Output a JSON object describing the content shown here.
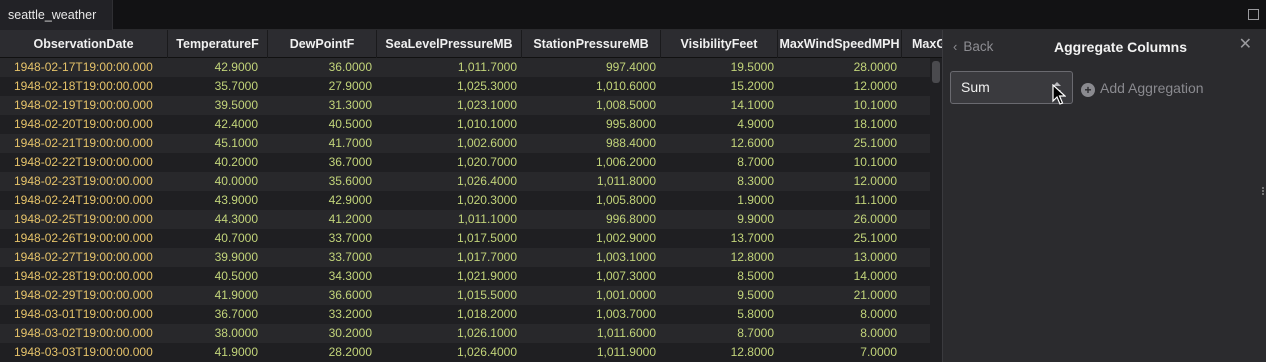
{
  "tab": {
    "title": "seattle_weather"
  },
  "columns": [
    "ObservationDate",
    "TemperatureF",
    "DewPointF",
    "SeaLevelPressureMB",
    "StationPressureMB",
    "VisibilityFeet",
    "MaxWindSpeedMPH",
    "MaxG"
  ],
  "rows": [
    [
      "1948-02-17T19:00:00.000",
      "42.9000",
      "36.0000",
      "1,011.7000",
      "997.4000",
      "19.5000",
      "28.0000"
    ],
    [
      "1948-02-18T19:00:00.000",
      "35.7000",
      "27.9000",
      "1,025.3000",
      "1,010.6000",
      "15.2000",
      "12.0000"
    ],
    [
      "1948-02-19T19:00:00.000",
      "39.5000",
      "31.3000",
      "1,023.1000",
      "1,008.5000",
      "14.1000",
      "10.1000"
    ],
    [
      "1948-02-20T19:00:00.000",
      "42.4000",
      "40.5000",
      "1,010.1000",
      "995.8000",
      "4.9000",
      "18.1000"
    ],
    [
      "1948-02-21T19:00:00.000",
      "45.1000",
      "41.7000",
      "1,002.6000",
      "988.4000",
      "12.6000",
      "25.1000"
    ],
    [
      "1948-02-22T19:00:00.000",
      "40.2000",
      "36.7000",
      "1,020.7000",
      "1,006.2000",
      "8.7000",
      "10.1000"
    ],
    [
      "1948-02-23T19:00:00.000",
      "40.0000",
      "35.6000",
      "1,026.4000",
      "1,011.8000",
      "8.3000",
      "12.0000"
    ],
    [
      "1948-02-24T19:00:00.000",
      "43.9000",
      "42.9000",
      "1,020.3000",
      "1,005.8000",
      "1.9000",
      "11.1000"
    ],
    [
      "1948-02-25T19:00:00.000",
      "44.3000",
      "41.2000",
      "1,011.1000",
      "996.8000",
      "9.9000",
      "26.0000"
    ],
    [
      "1948-02-26T19:00:00.000",
      "40.7000",
      "33.7000",
      "1,017.5000",
      "1,002.9000",
      "13.7000",
      "25.1000"
    ],
    [
      "1948-02-27T19:00:00.000",
      "39.9000",
      "33.7000",
      "1,017.7000",
      "1,003.1000",
      "12.8000",
      "13.0000"
    ],
    [
      "1948-02-28T19:00:00.000",
      "40.5000",
      "34.3000",
      "1,021.9000",
      "1,007.3000",
      "8.5000",
      "14.0000"
    ],
    [
      "1948-02-29T19:00:00.000",
      "41.9000",
      "36.6000",
      "1,015.5000",
      "1,001.0000",
      "9.5000",
      "21.0000"
    ],
    [
      "1948-03-01T19:00:00.000",
      "36.7000",
      "33.2000",
      "1,018.2000",
      "1,003.7000",
      "5.8000",
      "8.0000"
    ],
    [
      "1948-03-02T19:00:00.000",
      "38.0000",
      "30.2000",
      "1,026.1000",
      "1,011.6000",
      "8.7000",
      "8.0000"
    ],
    [
      "1948-03-03T19:00:00.000",
      "41.9000",
      "28.2000",
      "1,026.4000",
      "1,011.9000",
      "12.8000",
      "7.0000"
    ]
  ],
  "panel": {
    "back_label": "Back",
    "title": "Aggregate Columns",
    "close_icon": "close-icon",
    "aggregation_select": {
      "value": "Sum"
    },
    "add_aggregation_label": "Add Aggregation"
  },
  "colors": {
    "date_text": "#e6c36a",
    "number_text": "#c2d47a",
    "header_bg": "#2c2c30",
    "panel_bg": "#2b2b2e"
  }
}
